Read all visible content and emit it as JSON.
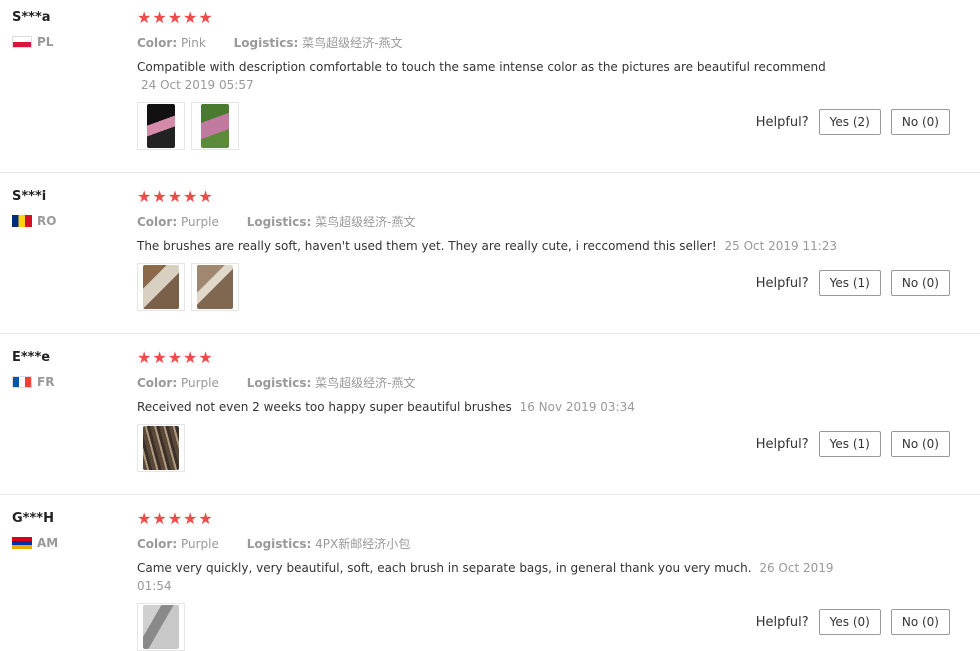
{
  "labels": {
    "color": "Color:",
    "logistics": "Logistics:",
    "helpful": "Helpful?"
  },
  "reviews": [
    {
      "user": "S***a",
      "country": "PL",
      "stars": "★★★★★",
      "color": "Pink",
      "logistics": "菜鸟超级经济-燕文",
      "text": "Compatible with description comfortable to touch the same intense color as the pictures are beautiful recommend",
      "date": "24 Oct 2019 05:57",
      "yes": "Yes (2)",
      "no": "No (0)",
      "thumb_colors": [
        "#2a2a2a",
        "#4a7a30"
      ]
    },
    {
      "user": "S***i",
      "country": "RO",
      "stars": "★★★★★",
      "color": "Purple",
      "logistics": "菜鸟超级经济-燕文",
      "text": "The brushes are really soft, haven't used them yet. They are really cute, i reccomend this seller!",
      "date": "25 Oct 2019 11:23",
      "yes": "Yes (1)",
      "no": "No (0)",
      "thumb_colors": [
        "#8a7050",
        "#9a8468"
      ]
    },
    {
      "user": "E***e",
      "country": "FR",
      "stars": "★★★★★",
      "color": "Purple",
      "logistics": "菜鸟超级经济-燕文",
      "text": "Received not even 2 weeks too happy super beautiful brushes",
      "date": "16 Nov 2019 03:34",
      "yes": "Yes (1)",
      "no": "No (0)",
      "thumb_colors": [
        "#6a5a4a"
      ]
    },
    {
      "user": "G***H",
      "country": "AM",
      "stars": "★★★★★",
      "color": "Purple",
      "logistics": "4PX新邮经济小包",
      "text": "Came very quickly, very beautiful, soft, each brush in separate bags, in general thank you very much.",
      "date": "26 Oct 2019 01:54",
      "yes": "Yes (0)",
      "no": "No (0)",
      "thumb_colors": [
        "#b8b8b8"
      ]
    }
  ]
}
